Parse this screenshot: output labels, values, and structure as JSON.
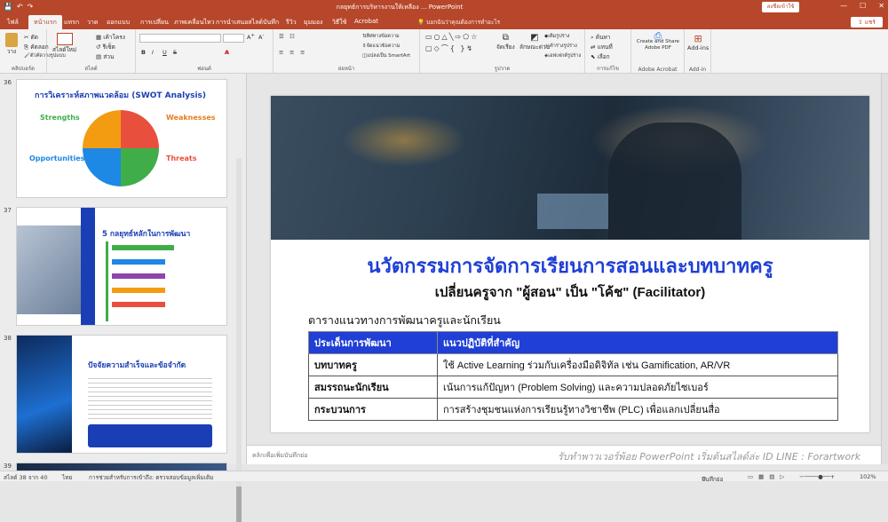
{
  "window": {
    "title": "กลยุทธ์การบริหารงานให้เหลือง ... PowerPoint",
    "sign_in": "ลงชื่อเข้าใช้",
    "share": "แชร์",
    "minimize": "—",
    "maximize": "☐",
    "close": "✕"
  },
  "tabs": [
    "ไฟล์",
    "หน้าแรก",
    "แทรก",
    "วาด",
    "ออกแบบ",
    "การเปลี่ยน",
    "ภาพเคลื่อนไหว",
    "การนำเสนอสไลด์",
    "บันทึก",
    "รีวิว",
    "มุมมอง",
    "วิธีใช้",
    "Acrobat"
  ],
  "active_tab": "หน้าแรก",
  "search_placeholder": "บอกฉันว่าคุณต้องการทำอะไร",
  "ribbon": {
    "clipboard": {
      "paste": "วาง",
      "cut": "ตัด",
      "copy": "คัดลอก",
      "format": "ตัวคัดวางรูปแบบ",
      "label": "คลิปบอร์ด"
    },
    "slides": {
      "new": "สไลด์ใหม่",
      "layout": "เค้าโครง",
      "reset": "รีเซ็ต",
      "section": "ส่วน",
      "label": "สไลด์"
    },
    "font": {
      "bold": "B",
      "italic": "I",
      "underline": "U",
      "strike": "S",
      "label": "ฟอนต์"
    },
    "paragraph": {
      "dir": "ทิศทางข้อความ",
      "align": "จัดแนวข้อความ",
      "smartart": "แปลงเป็น SmartArt",
      "label": "ย่อหน้า"
    },
    "drawing": {
      "arrange": "จัดเรียง",
      "styles": "ลักษณะด่วน",
      "fill": "เติมรูปร่าง",
      "outline": "เค้าร่างรูปร่าง",
      "effects": "เอฟเฟกต์รูปร่าง",
      "label": "รูปวาด"
    },
    "editing": {
      "find": "ค้นหา",
      "replace": "แทนที่",
      "select": "เลือก",
      "label": "การแก้ไข"
    },
    "acrobat": {
      "create": "Create and Share Adobe PDF",
      "label": "Adobe Acrobat"
    },
    "addins": {
      "btn": "Add-ins",
      "label": "Add-in"
    }
  },
  "thumbnails": [
    {
      "num": "36",
      "title": "การวิเคราะห์สภาพแวดล้อม (SWOT Analysis)",
      "strengths": "Strengths",
      "weaknesses": "Weaknesses",
      "opportunities": "Opportunities",
      "threats": "Threats"
    },
    {
      "num": "37",
      "title": "5 กลยุทธ์หลักในการพัฒนา"
    },
    {
      "num": "38",
      "title": "ปัจจัยความสำเร็จและข้อจำกัด"
    },
    {
      "num": "39"
    }
  ],
  "slide": {
    "title": "นวัตกรรมการจัดการเรียนการสอนและบทบาทครู",
    "subtitle": "เปลี่ยนครูจาก \"ผู้สอน\" เป็น \"โค้ช\" (Facilitator)",
    "table_caption": "ตารางแนวทางการพัฒนาครูและนักเรียน",
    "table": {
      "headers": [
        "ประเด็นการพัฒนา",
        "แนวปฏิบัติที่สำคัญ"
      ],
      "rows": [
        [
          "บทบาทครู",
          "ใช้ Active Learning ร่วมกับเครื่องมือดิจิทัล เช่น Gamification, AR/VR"
        ],
        [
          "สมรรถนะนักเรียน",
          "เน้นการแก้ปัญหา (Problem Solving) และความปลอดภัยไซเบอร์"
        ],
        [
          "กระบวนการ",
          "การสร้างชุมชนแห่งการเรียนรู้ทางวิชาชีพ (PLC) เพื่อแลกเปลี่ยนสื่อ"
        ]
      ]
    }
  },
  "notes_placeholder": "คลิกเพื่อเพิ่มบันทึกย่อ",
  "watermark": "รับทำพาวเวอร์พ้อย PowerPoint เริ่มต้นสไลด์ล่ะ ID LINE : Forartwork",
  "status": {
    "slide": "สไลด์ 38 จาก 40",
    "lang": "ไทย",
    "accessibility": "การช่วยสำหรับการเข้าถึง: ตรวจสอบข้อมูลเพิ่มเติม",
    "notes": "บันทึกย่อ",
    "zoom": "102%"
  },
  "colors": {
    "accent": "#b7472a",
    "title_blue": "#1f3fd6"
  }
}
